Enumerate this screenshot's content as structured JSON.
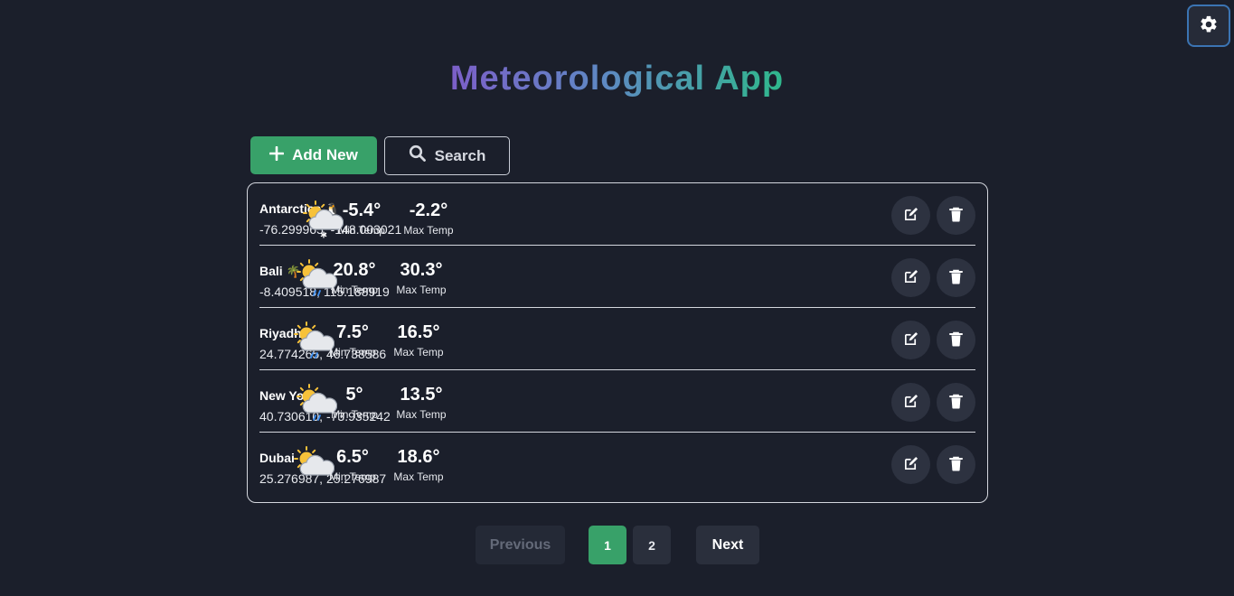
{
  "app": {
    "title": "Meteorological App"
  },
  "toolbar": {
    "add_label": "Add New",
    "search_label": "Search"
  },
  "rows": [
    {
      "name": "Antarctica",
      "emoji": "🐧",
      "coords": "-76.299965, -148.003021",
      "weather": "snow",
      "min": "-5.4°",
      "max": "-2.2°",
      "min_label": "Min Temp",
      "max_label": "Max Temp"
    },
    {
      "name": "Bali",
      "emoji": "🌴",
      "coords": "-8.409518, 115.188919",
      "weather": "rain",
      "min": "20.8°",
      "max": "30.3°",
      "min_label": "Min Temp",
      "max_label": "Max Temp"
    },
    {
      "name": "Riyadh",
      "emoji": "",
      "coords": "24.774265, 46.738586",
      "weather": "rain",
      "min": "7.5°",
      "max": "16.5°",
      "min_label": "Min Temp",
      "max_label": "Max Temp"
    },
    {
      "name": "New York",
      "emoji": "",
      "coords": "40.730610, -73.935242",
      "weather": "rain",
      "min": "5°",
      "max": "13.5°",
      "min_label": "Min Temp",
      "max_label": "Max Temp"
    },
    {
      "name": "Dubai",
      "emoji": "",
      "coords": "25.276987, 25.276987",
      "weather": "partly-cloudy",
      "min": "6.5°",
      "max": "18.6°",
      "min_label": "Min Temp",
      "max_label": "Max Temp"
    }
  ],
  "pagination": {
    "previous": "Previous",
    "page1": "1",
    "page2": "2",
    "next": "Next"
  },
  "icons": {
    "settings": "gear-icon",
    "add": "plus-icon",
    "search": "search-icon",
    "edit": "edit-icon",
    "delete": "trash-icon"
  },
  "colors": {
    "accent": "#38a169",
    "background": "#1b1f2b",
    "settings_border": "#3b74b3"
  }
}
